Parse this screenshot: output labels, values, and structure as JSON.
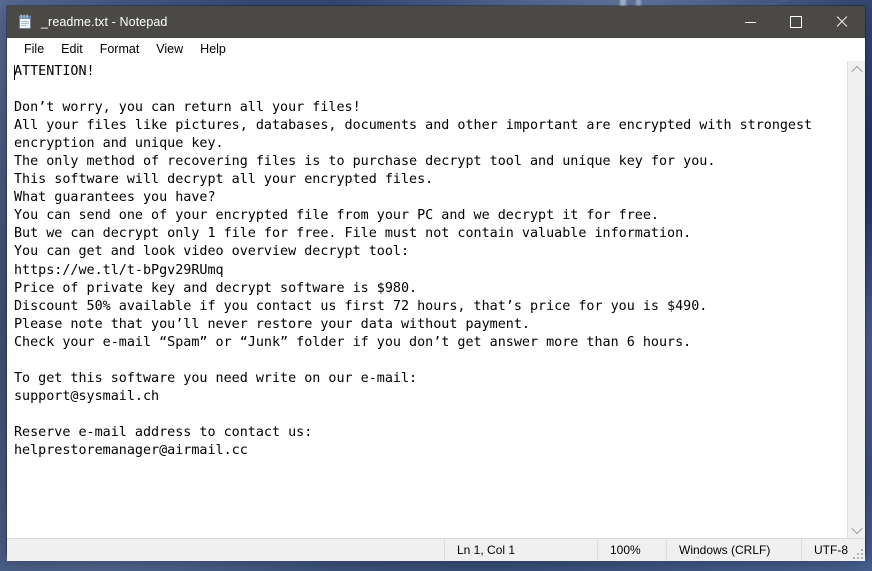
{
  "window": {
    "title": "_readme.txt - Notepad",
    "icon": "notepad-icon",
    "controls": {
      "minimize": "minimize-icon",
      "maximize": "maximize-icon",
      "close": "close-icon"
    }
  },
  "menu": {
    "items": [
      "File",
      "Edit",
      "Format",
      "View",
      "Help"
    ]
  },
  "editor": {
    "content": "ATTENTION!\n\nDon’t worry, you can return all your files!\nAll your files like pictures, databases, documents and other important are encrypted with strongest\nencryption and unique key.\nThe only method of recovering files is to purchase decrypt tool and unique key for you.\nThis software will decrypt all your encrypted files.\nWhat guarantees you have?\nYou can send one of your encrypted file from your PC and we decrypt it for free.\nBut we can decrypt only 1 file for free. File must not contain valuable information.\nYou can get and look video overview decrypt tool:\nhttps://we.tl/t-bPgv29RUmq\nPrice of private key and decrypt software is $980.\nDiscount 50% available if you contact us first 72 hours, that’s price for you is $490.\nPlease note that you’ll never restore your data without payment.\nCheck your e-mail “Spam” or “Junk” folder if you don’t get answer more than 6 hours.\n\nTo get this software you need write on our e-mail:\nsupport@sysmail.ch\n\nReserve e-mail address to contact us:\nhelprestoremanager@airmail.cc",
    "scrollbar": {
      "up_arrow": "chevron-up-icon",
      "down_arrow": "chevron-down-icon"
    }
  },
  "status_bar": {
    "cursor_position": "Ln 1, Col 1",
    "zoom": "100%",
    "line_ending": "Windows (CRLF)",
    "encoding": "UTF-8"
  },
  "colors": {
    "titlebar": "#4a4945",
    "window_bg": "#ffffff",
    "statusbar_bg": "#f0f0f0",
    "desktop": "#2c3f6b"
  }
}
